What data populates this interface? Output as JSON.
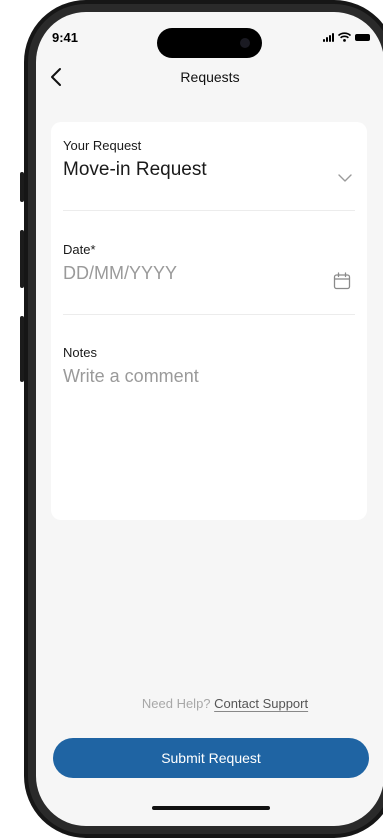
{
  "status_bar": {
    "time": "9:41"
  },
  "nav": {
    "title": "Requests",
    "back_icon": "chevron-left-icon"
  },
  "form": {
    "request": {
      "label": "Your Request",
      "value": "Move-in Request",
      "icon": "chevron-down-icon"
    },
    "date": {
      "label": "Date*",
      "placeholder": "DD/MM/YYYY",
      "icon": "calendar-icon"
    },
    "notes": {
      "label": "Notes",
      "placeholder": "Write a comment"
    }
  },
  "help": {
    "prompt": "Need Help?",
    "link": "Contact Support"
  },
  "submit_label": "Submit Request",
  "colors": {
    "primary": "#1f64a3",
    "background": "#f6f6f6",
    "card": "#ffffff"
  }
}
